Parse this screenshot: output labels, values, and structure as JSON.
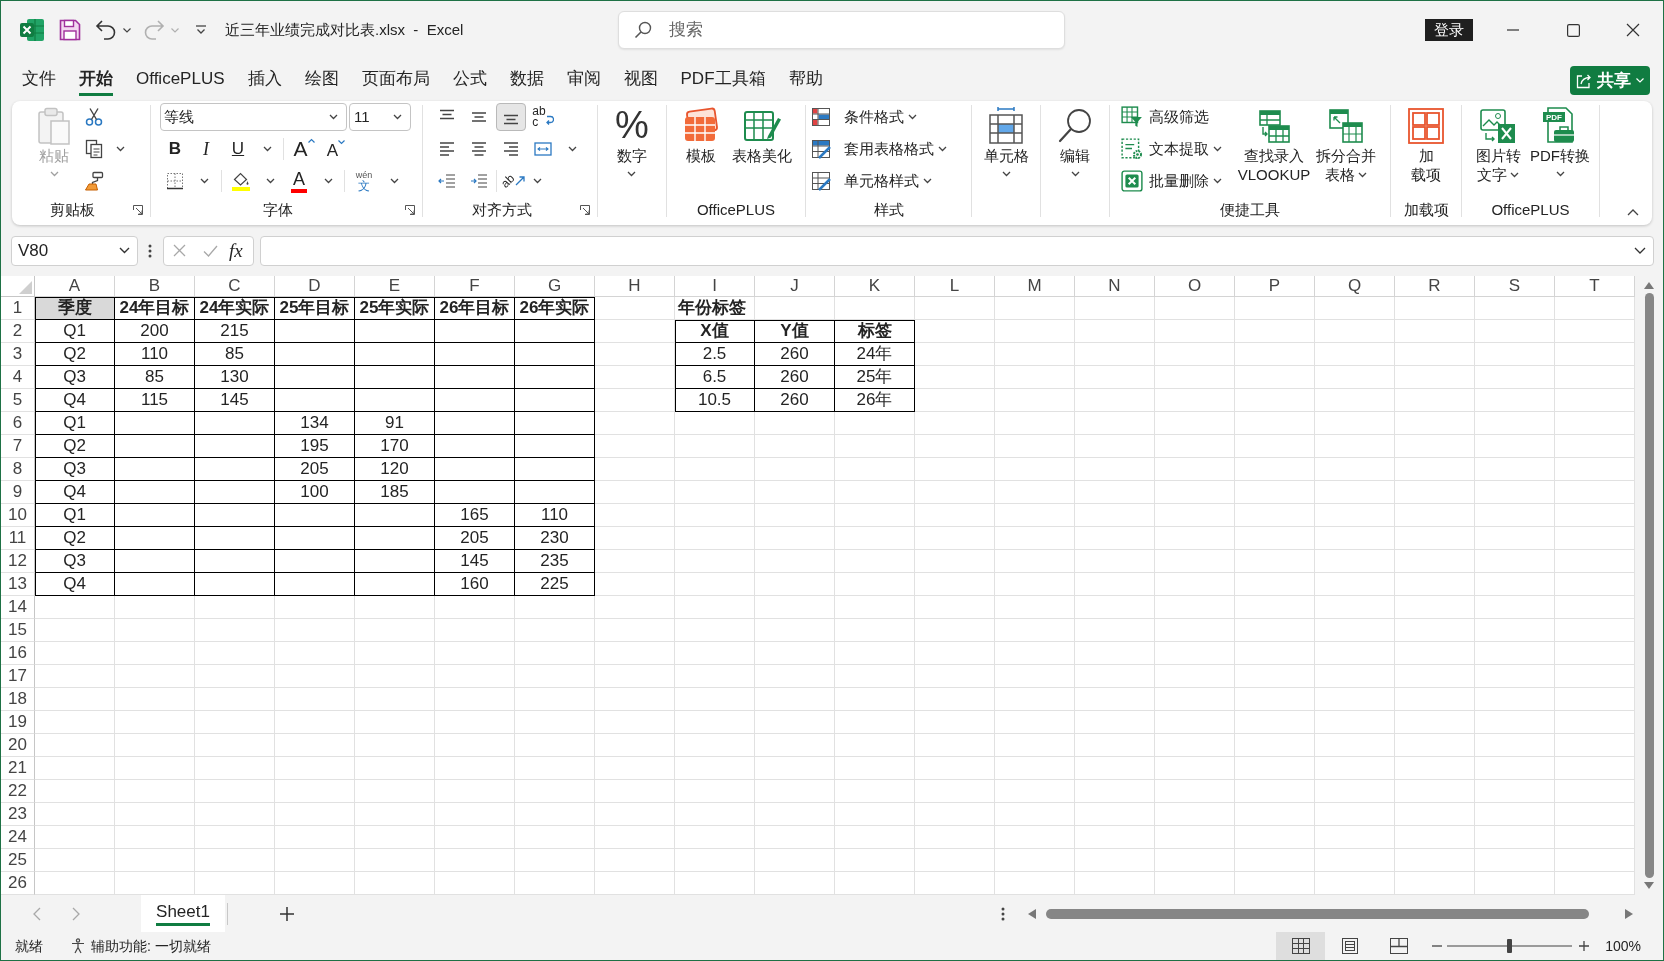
{
  "title_bar": {
    "title": "近三年业绩完成对比表.xlsx  -  Excel",
    "search": {
      "placeholder": "搜索"
    },
    "sign_in": "登录"
  },
  "ribbon_tabs": [
    {
      "label": "文件",
      "selected": false
    },
    {
      "label": "开始",
      "selected": true
    },
    {
      "label": "OfficePLUS",
      "selected": false
    },
    {
      "label": "插入",
      "selected": false
    },
    {
      "label": "绘图",
      "selected": false
    },
    {
      "label": "页面布局",
      "selected": false
    },
    {
      "label": "公式",
      "selected": false
    },
    {
      "label": "数据",
      "selected": false
    },
    {
      "label": "审阅",
      "selected": false
    },
    {
      "label": "视图",
      "selected": false
    },
    {
      "label": "PDF工具箱",
      "selected": false
    },
    {
      "label": "帮助",
      "selected": false
    }
  ],
  "share_button": "共享",
  "ribbon": {
    "clipboard": {
      "paste": {
        "label": "粘贴",
        "disabled": true
      },
      "label": "剪贴板"
    },
    "font": {
      "font_name": "等线",
      "font_size": "11",
      "bold": "B",
      "italic": "I",
      "underline": "U",
      "grow_font": "A",
      "shrink_font": "A",
      "font_color": "A",
      "phonetic_guide": {
        "pinyin": "wén",
        "character": "文"
      },
      "label": "字体"
    },
    "alignment": {
      "vertical": [
        {
          "selected": false
        },
        {
          "selected": false
        },
        {
          "selected": true
        }
      ],
      "wrap_text": {
        "line_1": "ab",
        "line_2": "c"
      },
      "orientation": "ab",
      "label": "对齐方式"
    },
    "number": {
      "symbol": "%",
      "button": "数字"
    },
    "officeplus": {
      "buttons": [
        "模板",
        "表格美化"
      ],
      "label": "OfficePLUS"
    },
    "styles": {
      "buttons": [
        "条件格式",
        "套用表格格式",
        "单元格样式"
      ],
      "label": "样式"
    },
    "cells": {
      "button": "单元格"
    },
    "editing": {
      "button": "编辑"
    },
    "tools": {
      "small_buttons": [
        "高级筛选",
        "文本提取",
        "批量删除"
      ],
      "large_buttons": [
        [
          "查找录入",
          "VLOOKUP"
        ],
        [
          "拆分合并",
          "表格"
        ]
      ],
      "label": "便捷工具"
    },
    "add_ins": {
      "button": [
        "加",
        "载项"
      ],
      "label": "加载项"
    },
    "officeplus_2": {
      "buttons": [
        [
          "图片转",
          "文字"
        ],
        [
          "PDF转换"
        ]
      ],
      "pdf_badge": "PDF",
      "label": "OfficePLUS"
    }
  },
  "formula_bar": {
    "name_box": "V80",
    "function_button": "fx"
  },
  "sheet": {
    "column_headers": [
      "A",
      "B",
      "C",
      "D",
      "E",
      "F",
      "G",
      "H",
      "I",
      "J",
      "K",
      "L",
      "M",
      "N",
      "O",
      "P",
      "Q",
      "R",
      "S",
      "T"
    ],
    "row_headers": [
      "1",
      "2",
      "3",
      "4",
      "5",
      "6",
      "7",
      "8",
      "9",
      "10",
      "11",
      "12",
      "13",
      "14",
      "15",
      "16",
      "17",
      "18",
      "19",
      "20",
      "21",
      "22",
      "23",
      "24",
      "25",
      "26"
    ],
    "tables": [
      {
        "header": [
          {
            "text": "季度",
            "shaded": true
          },
          {
            "text": "24年目标",
            "shaded": false
          },
          {
            "text": "24年实际",
            "shaded": false
          },
          {
            "text": "25年目标",
            "shaded": false
          },
          {
            "text": "25年实际",
            "shaded": false
          },
          {
            "text": "26年目标",
            "shaded": false
          },
          {
            "text": "26年实际",
            "shaded": false
          }
        ],
        "rows": [
          [
            "Q1",
            "200",
            "215",
            null,
            null,
            null,
            null
          ],
          [
            "Q2",
            "110",
            "85",
            null,
            null,
            null,
            null
          ],
          [
            "Q3",
            "85",
            "130",
            null,
            null,
            null,
            null
          ],
          [
            "Q4",
            "115",
            "145",
            null,
            null,
            null,
            null
          ],
          [
            "Q1",
            null,
            null,
            "134",
            "91",
            null,
            null
          ],
          [
            "Q2",
            null,
            null,
            "195",
            "170",
            null,
            null
          ],
          [
            "Q3",
            null,
            null,
            "205",
            "120",
            null,
            null
          ],
          [
            "Q4",
            null,
            null,
            "100",
            "185",
            null,
            null
          ],
          [
            "Q1",
            null,
            null,
            null,
            null,
            "165",
            "110"
          ],
          [
            "Q2",
            null,
            null,
            null,
            null,
            "205",
            "230"
          ],
          [
            "Q3",
            null,
            null,
            null,
            null,
            "145",
            "235"
          ],
          [
            "Q4",
            null,
            null,
            null,
            null,
            "160",
            "225"
          ]
        ]
      },
      {
        "title": "年份标签",
        "header": [
          {
            "text": "X值",
            "shaded": false
          },
          {
            "text": "Y值",
            "shaded": false
          },
          {
            "text": "标签",
            "shaded": false
          }
        ],
        "rows": [
          [
            "2.5",
            "260",
            "24年"
          ],
          [
            "6.5",
            "260",
            "25年"
          ],
          [
            "10.5",
            "260",
            "26年"
          ]
        ]
      }
    ]
  },
  "sheet_tabs": [
    {
      "label": "Sheet1",
      "selected": true
    }
  ],
  "status_bar": {
    "status": "就绪",
    "accessibility": "辅助功能: 一切就绪",
    "views": [
      {
        "selected": true
      },
      {
        "selected": false
      },
      {
        "selected": false
      }
    ],
    "zoom": {
      "level": 0.5,
      "percent": "100%"
    }
  }
}
